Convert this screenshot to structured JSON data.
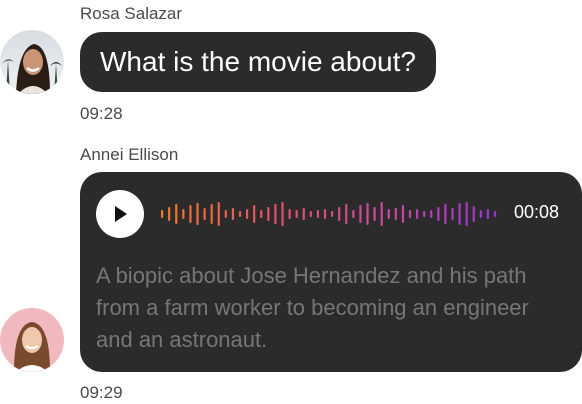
{
  "messages": [
    {
      "sender": "Rosa Salazar",
      "text": "What is the movie about?",
      "time": "09:28"
    },
    {
      "sender": "Annei Ellison",
      "audio": {
        "duration": "00:08",
        "transcript": "A biopic about Jose Hernandez and his path from a farm worker to becoming an engineer and an astronaut.",
        "waveform_colors": [
          "#f07a2a",
          "#e4506a",
          "#c84aa0",
          "#9b30d9"
        ]
      },
      "time": "09:29"
    }
  ],
  "colors": {
    "bubble": "#2b2b2b",
    "text_meta": "#4a4a4a",
    "transcript": "#767676"
  }
}
